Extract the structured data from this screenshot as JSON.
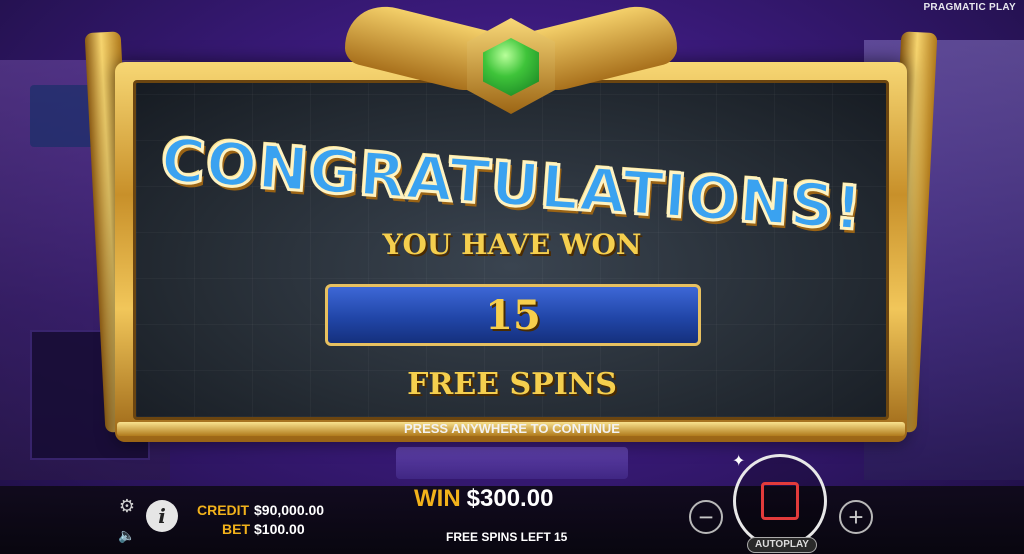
{
  "provider": "PRAGMATIC PLAY",
  "modal": {
    "headline": "CONGRATULATIONS!",
    "subline": "YOU HAVE WON",
    "amount": "15",
    "unit": "FREE SPINS",
    "continue_hint": "PRESS ANYWHERE TO CONTINUE"
  },
  "bottom_bar": {
    "credit_label": "CREDIT",
    "credit_value": "$90,000.00",
    "bet_label": "BET",
    "bet_value": "$100.00",
    "win_label": "WIN",
    "win_value": "$300.00",
    "free_spins_left": "FREE SPINS LEFT 15",
    "autoplay_label": "AUTOPLAY",
    "info_icon_text": "i",
    "minus_text": "−",
    "plus_text": "+"
  },
  "icons": [
    "gear-icon",
    "speaker-icon",
    "info-icon",
    "minus-icon",
    "plus-icon",
    "spin-stop-icon",
    "sparkle-icon",
    "green-gem-icon"
  ],
  "colors": {
    "accent_gold": "#f2b21b",
    "title_blue": "#3aa2f0",
    "frame_gold": "#f1c65a",
    "background_purple": "#3a1a7a",
    "stop_red": "#e23b3b"
  }
}
